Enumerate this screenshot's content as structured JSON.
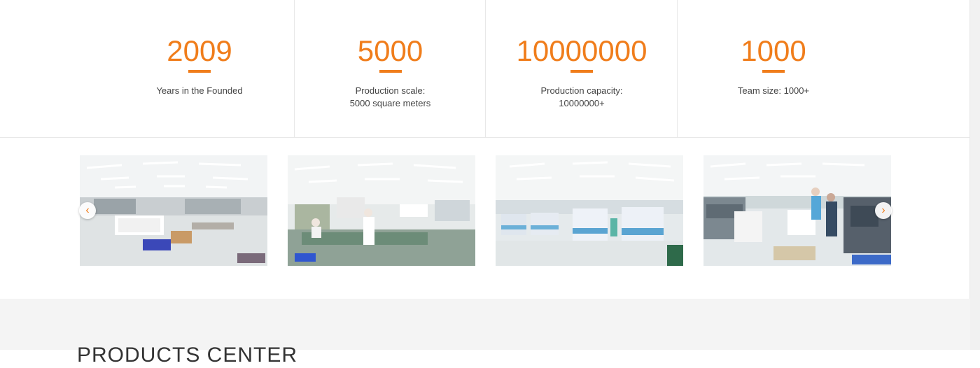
{
  "stats": [
    {
      "number": "2009",
      "desc_line1": "Years in the Founded",
      "desc_line2": ""
    },
    {
      "number": "5000",
      "desc_line1": "Production scale:",
      "desc_line2": "5000 square meters"
    },
    {
      "number": "10000000",
      "desc_line1": "Production capacity:",
      "desc_line2": "10000000+"
    },
    {
      "number": "1000",
      "desc_line1": "Team size: 1000+",
      "desc_line2": ""
    }
  ],
  "gallery": {
    "prev_icon": "chevron-left-icon",
    "next_icon": "chevron-right-icon",
    "prev_glyph": "‹",
    "next_glyph": "›",
    "photos": [
      "factory-warehouse-photo",
      "factory-packing-photo",
      "factory-printing-line-photo",
      "factory-press-room-photo"
    ]
  },
  "products": {
    "title": "PRODUCTS CENTER"
  },
  "colors": {
    "accent": "#f07d1b",
    "band": "#f4f4f4"
  }
}
